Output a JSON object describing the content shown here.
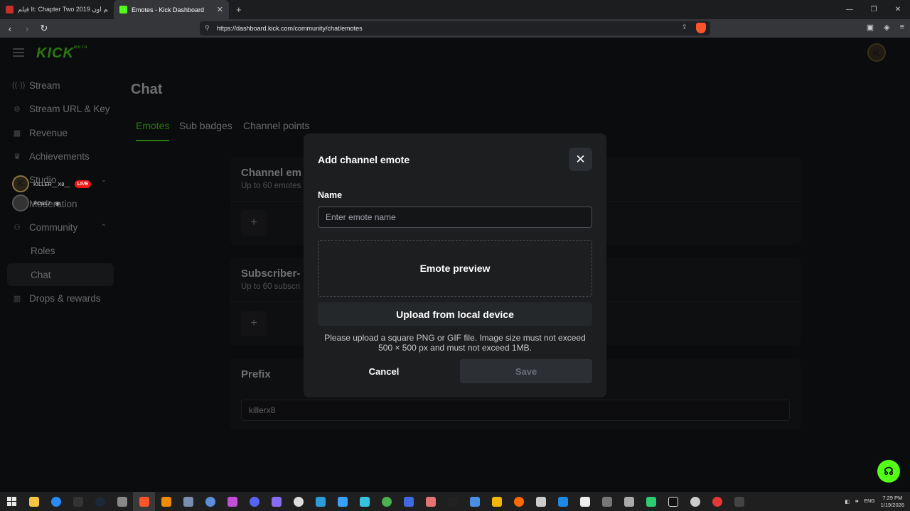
{
  "browser": {
    "tabs": [
      {
        "label": "فيلم It: Chapter Two 2019 مترجم اون",
        "favicon_color": "#c4302b",
        "active": false
      },
      {
        "label": "Emotes - Kick Dashboard",
        "favicon_color": "#53fc18",
        "active": true
      }
    ],
    "url": "https://dashboard.kick.com/community/chat/emotes",
    "new_tab": "+",
    "window_controls": [
      "—",
      "❐",
      "✕"
    ]
  },
  "header": {
    "logo": "KICK",
    "logo_tag": "BETA",
    "avatar_letter": "K"
  },
  "sidebar": {
    "items": [
      {
        "label": "Stream",
        "icon": "broadcast-icon"
      },
      {
        "label": "Stream URL & Key",
        "icon": "link-icon"
      },
      {
        "label": "Revenue",
        "icon": "revenue-icon"
      },
      {
        "label": "Achievements",
        "icon": "trophy-icon"
      },
      {
        "label": "Studio",
        "icon": "studio-icon"
      },
      {
        "label": "Moderation",
        "icon": "shield-icon"
      },
      {
        "label": "Community",
        "icon": "community-icon"
      },
      {
        "label": "Roles",
        "icon": ""
      },
      {
        "label": "Chat",
        "icon": ""
      },
      {
        "label": "Drops & rewards",
        "icon": "gift-icon"
      }
    ],
    "live_users": [
      {
        "name": "KILLER__X8__",
        "badge": "LIVE"
      },
      {
        "name": "POSL7",
        "badge": ""
      }
    ]
  },
  "main": {
    "title": "Chat",
    "tabs": [
      "Emotes",
      "Sub badges",
      "Channel points"
    ],
    "channel_card": {
      "title": "Channel em",
      "subtitle": "Up to 60 emotes"
    },
    "subscriber_card": {
      "title": "Subscriber-",
      "subtitle": "Up to 60 subscri"
    },
    "prefix_card": {
      "title": "Prefix",
      "value": "killerx8"
    }
  },
  "modal": {
    "title": "Add channel emote",
    "name_label": "Name",
    "name_placeholder": "Enter emote name",
    "preview_label": "Emote preview",
    "upload_label": "Upload from local device",
    "hint": "Please upload a square PNG or GIF file. Image size must not exceed 500 × 500 px and must not exceed 1MB.",
    "cancel_label": "Cancel",
    "save_label": "Save"
  },
  "taskbar": {
    "time": "7:29 PM",
    "date": "1/19/2026",
    "language": "ENG"
  },
  "colors": {
    "accent": "#53fc18",
    "live": "#e91916",
    "background": "#0b0c0d"
  }
}
